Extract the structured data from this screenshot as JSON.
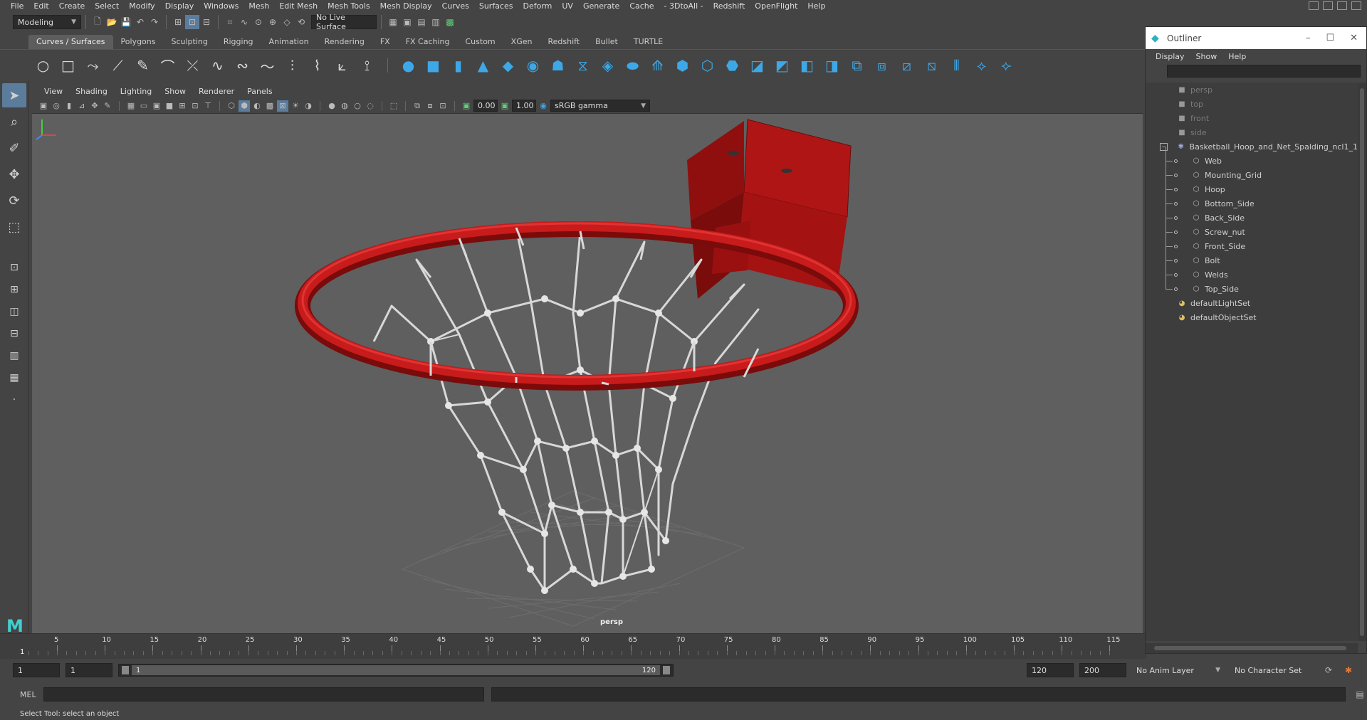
{
  "menubar": {
    "items": [
      "File",
      "Edit",
      "Create",
      "Select",
      "Modify",
      "Display",
      "Windows",
      "Mesh",
      "Edit Mesh",
      "Mesh Tools",
      "Mesh Display",
      "Curves",
      "Surfaces",
      "Deform",
      "UV",
      "Generate",
      "Cache",
      "- 3DtoAll -",
      "Redshift",
      "OpenFlight",
      "Help"
    ]
  },
  "statusline": {
    "workspace": "Modeling",
    "live_surface": "No Live Surface"
  },
  "shelf": {
    "tabs": [
      "Curves / Surfaces",
      "Polygons",
      "Sculpting",
      "Rigging",
      "Animation",
      "Rendering",
      "FX",
      "FX Caching",
      "Custom",
      "XGen",
      "Redshift",
      "Bullet",
      "TURTLE"
    ],
    "active_tab": "Curves / Surfaces"
  },
  "panel": {
    "menu": [
      "View",
      "Shading",
      "Lighting",
      "Show",
      "Renderer",
      "Panels"
    ],
    "exposure": "0.00",
    "gamma": "1.00",
    "color_space": "sRGB gamma",
    "camera_label": "persp"
  },
  "timeline": {
    "ticks": [
      "5",
      "10",
      "15",
      "20",
      "25",
      "30",
      "35",
      "40",
      "45",
      "50",
      "55",
      "60",
      "65",
      "70",
      "75",
      "80",
      "85",
      "90",
      "95",
      "100",
      "105",
      "110",
      "115"
    ],
    "current_frame": "1"
  },
  "range": {
    "start": "1",
    "playback_start": "1",
    "range_left": "1",
    "range_right": "120",
    "playback_end": "120",
    "end": "200",
    "anim_layer": "No Anim Layer",
    "character_set": "No Character Set"
  },
  "cmdline": {
    "label": "MEL"
  },
  "helpline": {
    "text": "Select Tool: select an object"
  },
  "outliner": {
    "title": "Outliner",
    "menu": [
      "Display",
      "Show",
      "Help"
    ],
    "cameras": [
      "persp",
      "top",
      "front",
      "side"
    ],
    "root": "Basketball_Hoop_and_Net_Spalding_ncl1_1",
    "children": [
      "Web",
      "Mounting_Grid",
      "Hoop",
      "Bottom_Side",
      "Back_Side",
      "Screw_nut",
      "Front_Side",
      "Bolt",
      "Welds",
      "Top_Side"
    ],
    "sets": [
      "defaultLightSet",
      "defaultObjectSet"
    ]
  },
  "colors": {
    "hoop_red": "#c01818",
    "net_white": "#d8d8d8",
    "viewport_bg": "#5f5f5f",
    "accent_blue": "#3da8e8"
  }
}
